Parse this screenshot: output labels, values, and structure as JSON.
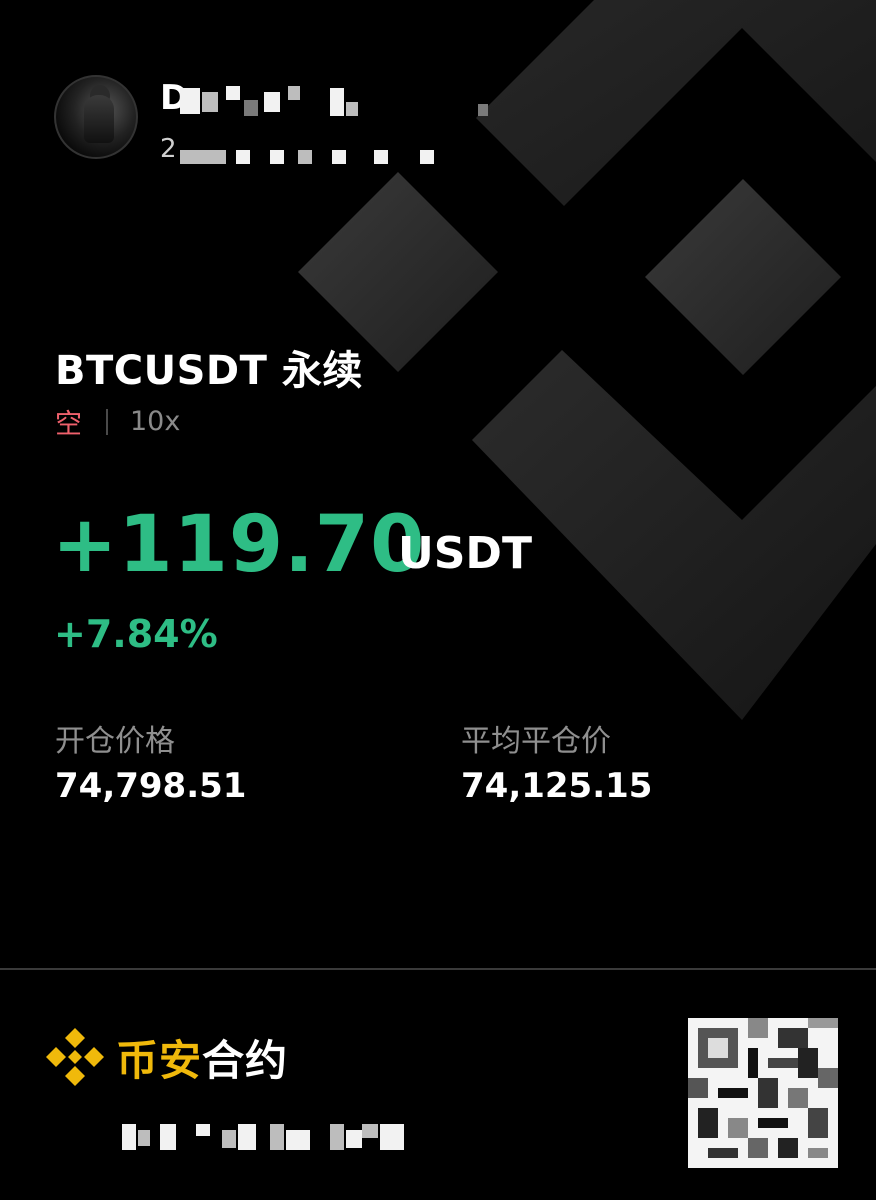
{
  "user": {
    "name_visible": "D",
    "id_visible": "2",
    "avatar_alt": "user-avatar"
  },
  "position": {
    "symbol": "BTCUSDT 永续",
    "side": "空",
    "leverage": "10x",
    "pnl": "+119.70",
    "pnl_unit": "USDT",
    "roi": "+7.84%"
  },
  "prices": {
    "entry_label": "开仓价格",
    "entry_value": "74,798.51",
    "close_label": "平均平仓价",
    "close_value": "74,125.15"
  },
  "brand": {
    "name_yellow": "币安",
    "name_white": "合约"
  },
  "colors": {
    "profit": "#2ebd85",
    "short": "#f0616d",
    "brand": "#f0b90b",
    "background": "#000000"
  }
}
